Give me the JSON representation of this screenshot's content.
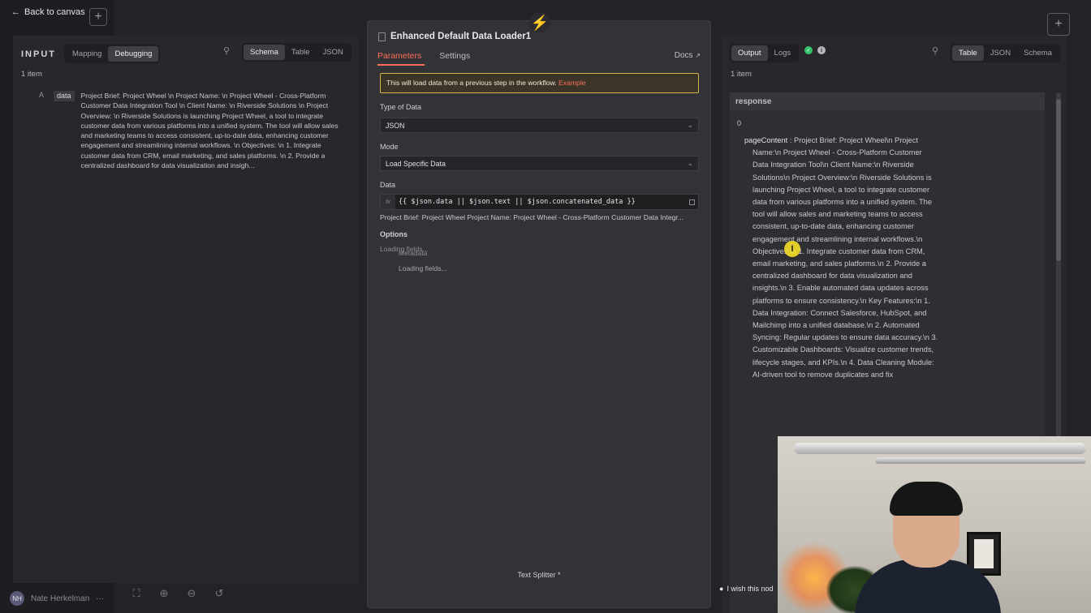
{
  "topbar": {
    "back_label": "Back to canvas"
  },
  "input_panel": {
    "title": "INPUT",
    "mode_tabs": [
      "Mapping",
      "Debugging"
    ],
    "view_tabs": [
      "Schema",
      "Table",
      "JSON"
    ],
    "item_count": "1 item",
    "field": {
      "type": "A",
      "key": "data",
      "value": "Project Brief: Project Wheel \\n Project Name: \\n Project Wheel - Cross-Platform Customer Data Integration Tool \\n Client Name: \\n Riverside Solutions \\n Project Overview: \\n Riverside Solutions is launching Project Wheel, a tool to integrate customer data from various platforms into a unified system. The tool will allow sales and marketing teams to access consistent, up-to-date data, enhancing customer engagement and streamlining internal workflows. \\n Objectives: \\n 1. Integrate customer data from CRM, email marketing, and sales platforms. \\n 2. Provide a centralized dashboard for data visualization and insigh..."
    }
  },
  "node": {
    "title": "Enhanced Default Data Loader1",
    "tabs": [
      "Parameters",
      "Settings"
    ],
    "docs_label": "Docs",
    "notice": "This will load data from a previous step in the workflow.",
    "notice_link": "Example",
    "type_label": "Type of Data",
    "type_value": "JSON",
    "mode_label": "Mode",
    "mode_value": "Load Specific Data",
    "data_label": "Data",
    "fx": "fx",
    "expression": "{{ $json.data || $json.text || $json.concatenated_data }}",
    "expression_preview": "Project Brief: Project Wheel Project Name: Project Wheel - Cross-Platform Customer Data Integr...",
    "options_label": "Options",
    "loading_1": "Loading fields...",
    "metadata_label": "Metadata",
    "loading_2": "Loading fields...",
    "bottom_label": "Text Splitter *"
  },
  "output_panel": {
    "mode_tabs": [
      "Output",
      "Logs"
    ],
    "view_tabs": [
      "Table",
      "JSON",
      "Schema"
    ],
    "item_count": "1 item",
    "column_header": "response",
    "row_index": "0",
    "key": "pageContent",
    "value": "Project Brief: Project Wheel\\n Project Name:\\n Project Wheel - Cross-Platform Customer Data Integration Tool\\n Client Name:\\n Riverside Solutions\\n Project Overview:\\n Riverside Solutions is launching Project Wheel, a tool to integrate customer data from various platforms into a unified system. The tool will allow sales and marketing teams to access consistent, up-to-date data, enhancing customer engagement and streamlining internal workflows.\\n Objectives:\\n 1. Integrate customer data from CRM, email marketing, and sales platforms.\\n 2. Provide a centralized dashboard for data visualization and insights.\\n 3. Enable automated data updates across platforms to ensure consistency.\\n Key Features:\\n 1. Data Integration: Connect Salesforce, HubSpot, and Mailchimp into a unified database.\\n 2. Automated Syncing: Regular updates to ensure data accuracy.\\n 3. Customizable Dashboards: Visualize customer trends, lifecycle stages, and KPIs.\\n 4. Data Cleaning Module: AI-driven tool to remove duplicates and fix"
  },
  "footer": {
    "avatar_initials": "NH",
    "user_name": "Nate Herkelman",
    "more": "···",
    "hint": "I wish this nod"
  },
  "colors": {
    "accent": "#ff6d5a",
    "success": "#32c46a",
    "node_icon": "#2fdc8e",
    "warning_border": "#d8b24a"
  }
}
